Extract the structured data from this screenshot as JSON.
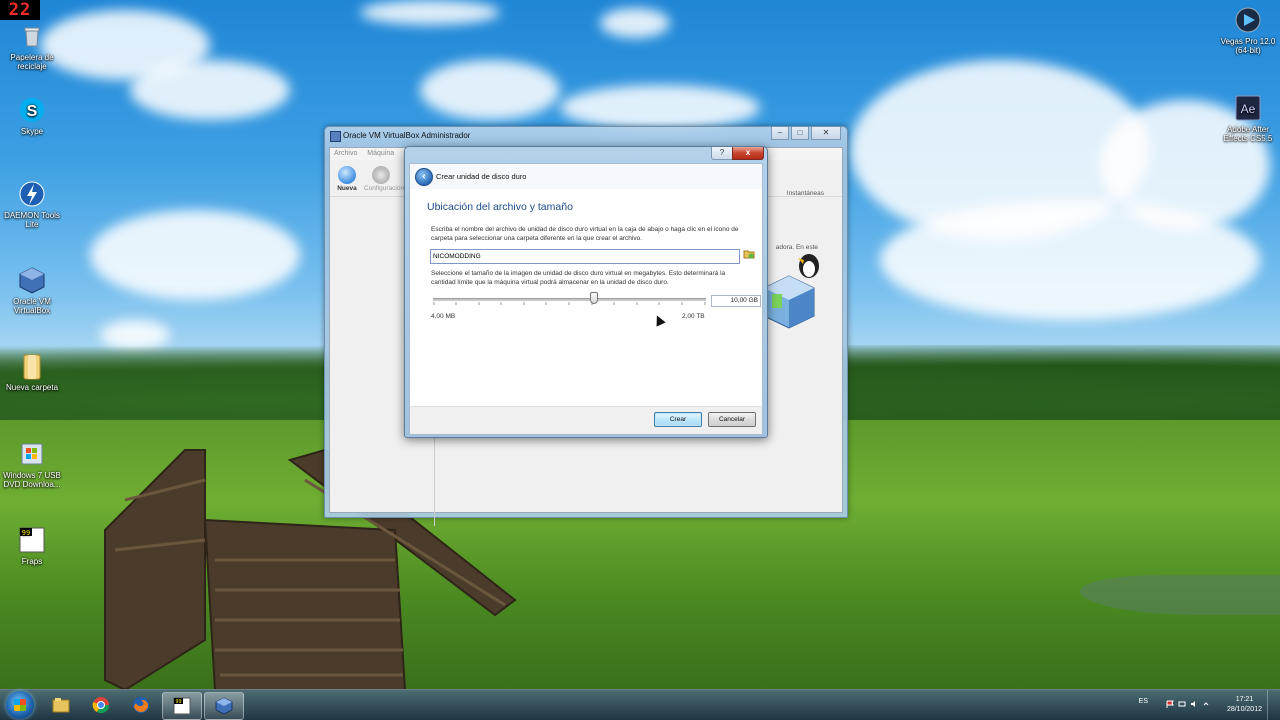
{
  "fraps": {
    "counter": "22"
  },
  "desktop_icons": {
    "recycle": "Papelera de reciclaje",
    "skype": "Skype",
    "daemon": "DAEMON Tools Lite",
    "virtualbox": "Oracle VM VirtualBox",
    "folder": "Nueva carpeta",
    "usbdvd": "Windows 7 USB DVD Downloa...",
    "fraps": "Fraps",
    "vegas": "Vegas Pro 12.0 (64-bit)",
    "aftereffects": "Adobe After Effects CS5.5"
  },
  "vbox": {
    "title": "Oracle VM VirtualBox Administrador",
    "menu": [
      "Archivo",
      "Máquina"
    ],
    "toolbar": {
      "new": "Nueva",
      "config": "Configuración"
    },
    "snapshots": "Instantáneas",
    "welcome": "adora. En este"
  },
  "dialog": {
    "help": "?",
    "close": "x",
    "header": "Crear unidad de disco duro",
    "section_title": "Ubicación del archivo y tamaño",
    "desc1": "Escriba el nombre del archivo de unidad de disco duro virtual en la caja de abajo o haga clic en el icono de carpeta para seleccionar una carpeta diferente en la que crear el archivo.",
    "filename": "NICOMODDING",
    "desc2": "Seleccione el tamaño de la imagen de unidad de disco duro virtual en megabytes. Esto determinará la cantidad límite que la máquina virtual podrá almacenar en la unidad de disco duro.",
    "size_value": "10,00 GB",
    "slider_fraction": 0.59,
    "min_label": "4,00 MB",
    "max_label": "2,00 TB",
    "create": "Crear",
    "cancel": "Cancelar"
  },
  "taskbar": {
    "language": "ES",
    "time": "17:21",
    "date": "28/10/2012"
  }
}
